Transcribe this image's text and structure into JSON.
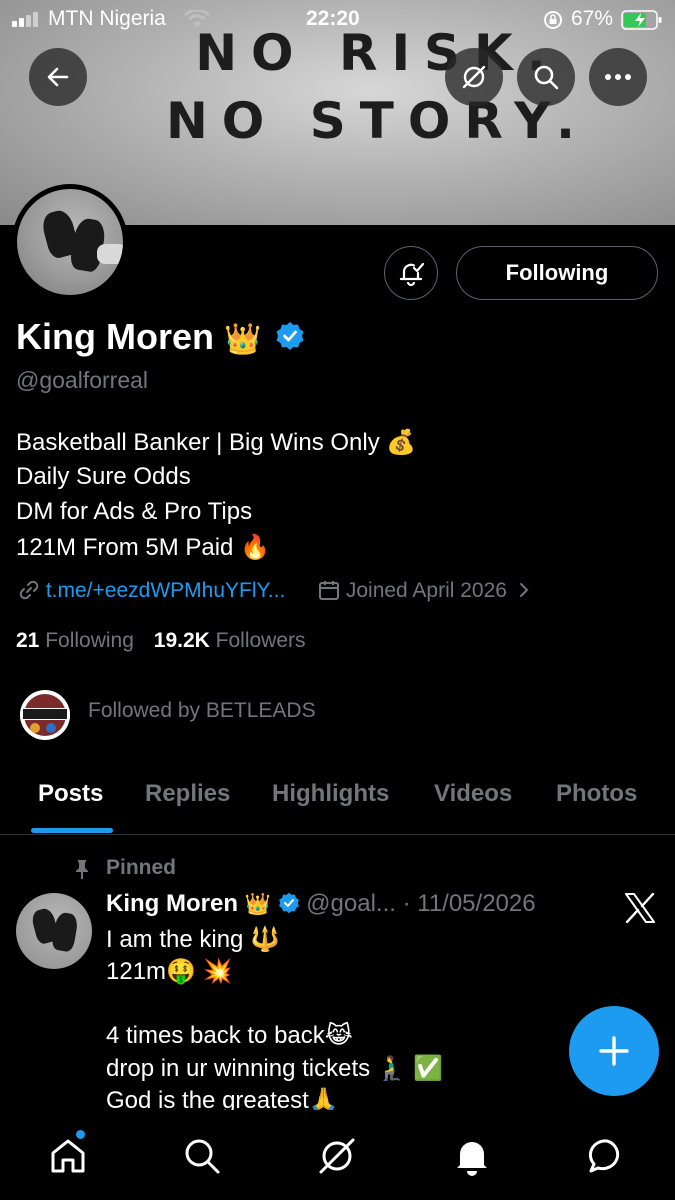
{
  "status_bar": {
    "carrier": "MTN Nigeria",
    "time": "22:20",
    "battery": "67%"
  },
  "banner": {
    "line1": "NO RISK.",
    "line2": "NO STORY."
  },
  "profile": {
    "name": "King Moren",
    "name_emoji": "👑",
    "handle": "@goalforreal",
    "bio": [
      "Basketball Banker | Big Wins Only 💰",
      "Daily Sure Odds",
      "DM for Ads & Pro Tips",
      "121M From 5M Paid 🔥"
    ],
    "link": "t.me/+eezdWPMhuYFlY...",
    "joined": "Joined April 2026",
    "following_count": "21",
    "following_label": "Following",
    "followers_count": "19.2K",
    "followers_label": "Followers",
    "followed_by": "Followed by BETLEADS",
    "follow_button": "Following"
  },
  "tabs": [
    "Posts",
    "Replies",
    "Highlights",
    "Videos",
    "Photos"
  ],
  "post": {
    "pinned_label": "Pinned",
    "author_name": "King Moren",
    "author_emoji": "👑",
    "handle": "@goal...",
    "date": "· 11/05/2026",
    "lines": [
      "I am the king 🔱",
      "121m🤑 💥",
      "",
      "4 times back to back😹",
      "drop in ur winning tickets 🧎‍♂️ ✅",
      "God is the greatest🙏"
    ]
  },
  "colors": {
    "accent": "#1d9bf0",
    "muted": "#71767b",
    "background": "#000000"
  }
}
